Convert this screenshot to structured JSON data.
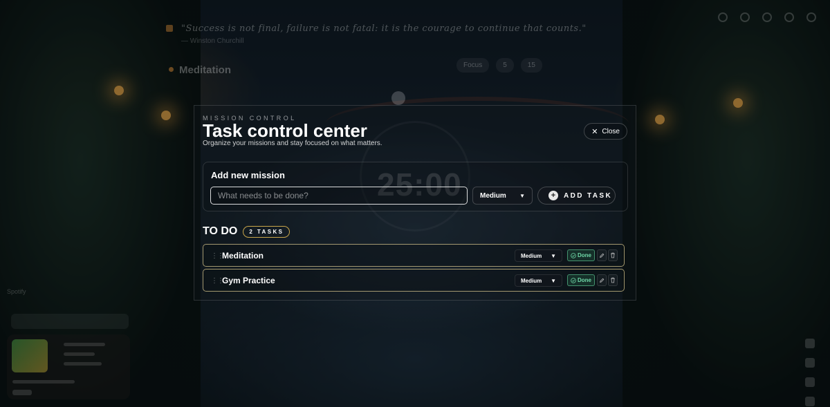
{
  "background": {
    "quote": "\"Success is not final, failure is not fatal: it is the courage to continue that counts.\"",
    "quote_author": "— Winston Churchill",
    "current_task": "Meditation",
    "timer": "25:00",
    "mode_pills": [
      "Focus",
      "5",
      "15"
    ],
    "side_label": "Spotify"
  },
  "modal": {
    "eyebrow": "MISSION CONTROL",
    "title": "Task control center",
    "subtitle": "Organize your missions and stay focused on what matters.",
    "close_label": "Close",
    "add_panel": {
      "title": "Add new mission",
      "input_placeholder": "What needs to be done?",
      "input_value": "",
      "priority_selected": "Medium",
      "add_label": "ADD TASK"
    },
    "todo": {
      "title": "TO DO",
      "count_label": "2 TASKS",
      "tasks": [
        {
          "name": "Meditation",
          "priority": "Medium",
          "done_label": "Done"
        },
        {
          "name": "Gym Practice",
          "priority": "Medium",
          "done_label": "Done"
        }
      ]
    }
  },
  "colors": {
    "accent_gold": "#c9a64a",
    "done_green": "#6fd9a8",
    "lamp_orange": "#ffb54a"
  },
  "icons": {
    "close": "close-icon",
    "add": "plus-circle-icon",
    "drag": "drag-handle-icon",
    "done": "check-circle-icon",
    "edit": "pencil-icon",
    "delete": "trash-icon"
  }
}
